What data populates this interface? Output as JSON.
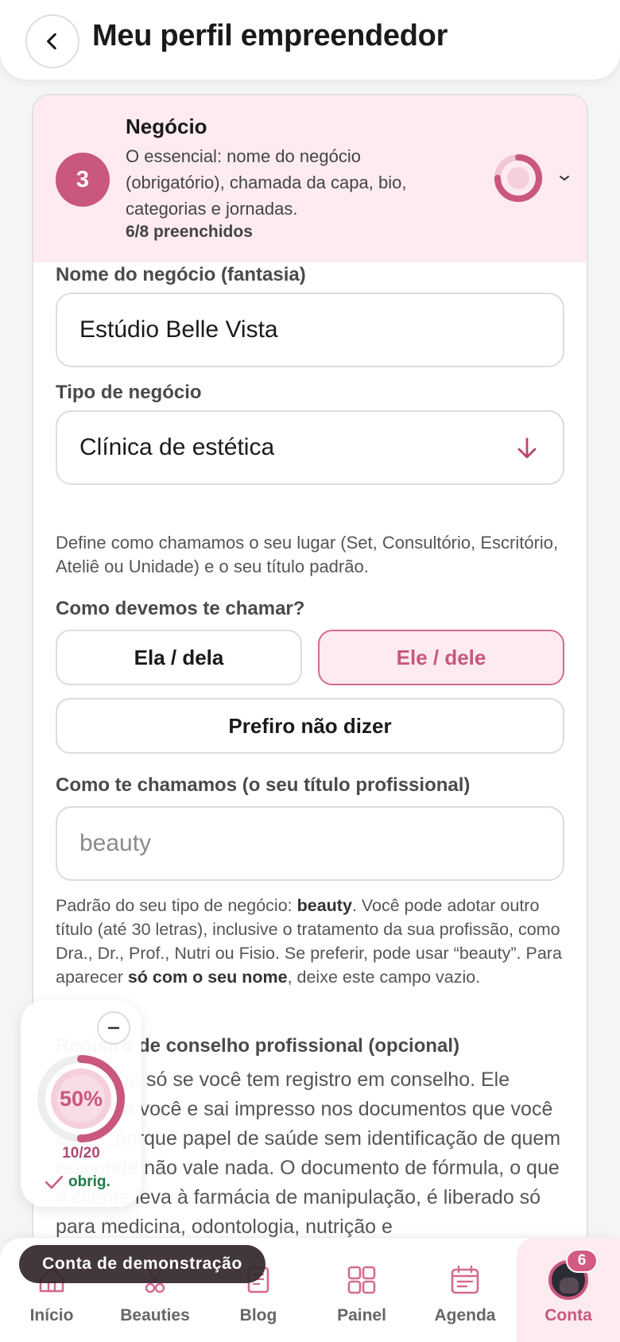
{
  "header": {
    "title": "Meu perfil empreendedor"
  },
  "section": {
    "step": "3",
    "title": "Negócio",
    "description": "O essencial: nome do negócio (obrigatório), chamada da capa, bio, categorias e jornadas.",
    "filled": "6/8 preenchidos",
    "progress_fraction": 0.75
  },
  "form": {
    "business_name_label": "Nome do negócio (fantasia)",
    "business_name_value": "Estúdio Belle Vista",
    "business_type_label": "Tipo de negócio",
    "business_type_value": "Clínica de estética",
    "business_type_hint": "Define como chamamos o seu lugar (Set, Consultório, Escritório, Ateliê ou Unidade) e o seu título padrão.",
    "pronoun_label": "Como devemos te chamar?",
    "pronoun_options": [
      "Ela / dela",
      "Ele / dele",
      "Prefiro não dizer"
    ],
    "pronoun_selected": "Ele / dele",
    "title_label": "Como te chamamos (o seu título profissional)",
    "title_placeholder": "beauty",
    "title_hint_1": "Padrão do seu tipo de negócio: ",
    "title_hint_bold_1": "beauty",
    "title_hint_2": ". Você pode adotar outro título (até 30 letras), inclusive o tratamento da sua profissão, como Dra., Dr., Prof., Nutri ou Fisio. Se preferir, pode usar “beauty”. Para aparecer ",
    "title_hint_bold_2": "só com o seu nome",
    "title_hint_3": ", deixe este campo vazio.",
    "council_label": "Registro de conselho profissional (opcional)",
    "council_text": "Preencha só se você tem registro em conselho. Ele identifica você e sai impresso nos documentos que você emite, porque papel de saúde sem identificação de quem responde não vale nada. O documento de fórmula, o que a cliente leva à farmácia de manipulação, é liberado só para medicina, odontologia, nutrição e"
  },
  "progress_widget": {
    "percent_label": "50%",
    "percent_value": 0.5,
    "count": "10/20",
    "required_label": "obrig."
  },
  "nav": {
    "items": [
      {
        "label": "Início",
        "icon": "home-icon"
      },
      {
        "label": "Beauties",
        "icon": "beauties-icon"
      },
      {
        "label": "Blog",
        "icon": "blog-icon"
      },
      {
        "label": "Painel",
        "icon": "grid-icon"
      },
      {
        "label": "Agenda",
        "icon": "calendar-icon"
      },
      {
        "label": "Conta",
        "icon": "avatar"
      }
    ],
    "active": "Conta",
    "badge": "6"
  },
  "demo_label": "Conta de demonstração",
  "colors": {
    "accent": "#c9577e",
    "accent_light": "#fdebef",
    "success": "#1e7a4a"
  }
}
